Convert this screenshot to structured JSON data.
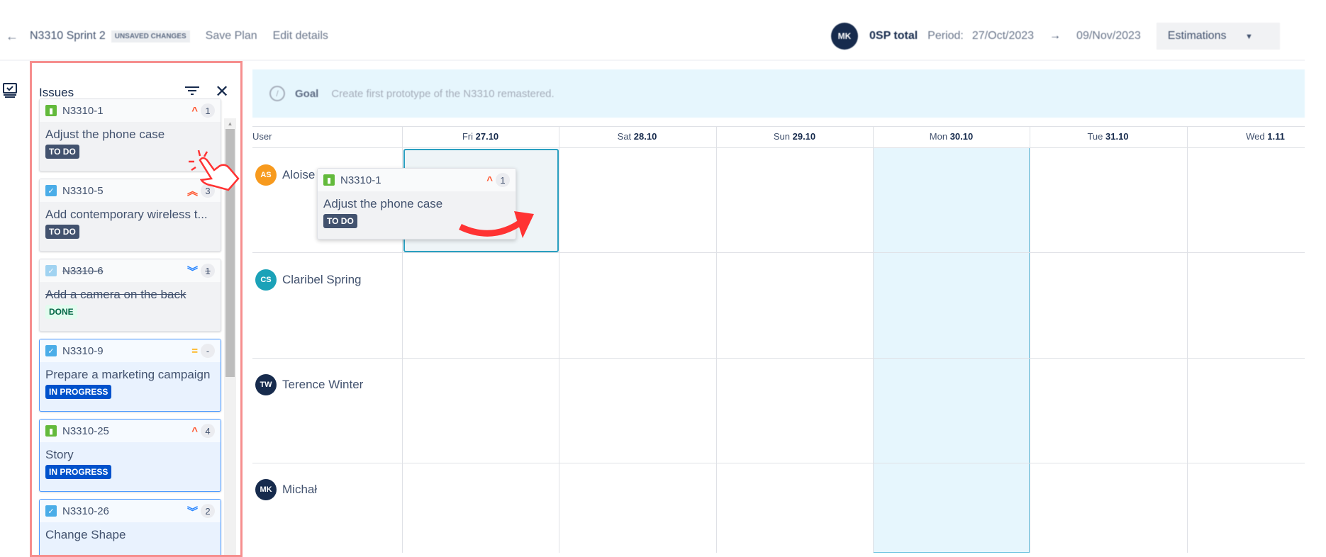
{
  "header": {
    "sprint_name": "N3310 Sprint 2",
    "unsaved_badge": "UNSAVED CHANGES",
    "save_plan": "Save Plan",
    "edit_details": "Edit details",
    "user_initials": "MK",
    "total": "0SP total",
    "period_label": "Period:",
    "period_start": "27/Oct/2023",
    "period_end": "09/Nov/2023",
    "estimations": "Estimations"
  },
  "issues_panel": {
    "title": "Issues",
    "issues": [
      {
        "key": "N3310-1",
        "type": "story",
        "priority": "high",
        "points": "1",
        "title": "Adjust the phone case",
        "status": "TO DO"
      },
      {
        "key": "N3310-5",
        "type": "task",
        "priority": "highest",
        "points": "3",
        "title": "Add contemporary wireless t...",
        "status": "TO DO"
      },
      {
        "key": "N3310-6",
        "type": "task",
        "priority": "lowest",
        "points": "1",
        "title": "Add a camera on the back",
        "status": "DONE"
      },
      {
        "key": "N3310-9",
        "type": "task",
        "priority": "medium",
        "points": "-",
        "title": "Prepare a marketing campaign",
        "status": "IN PROGRESS"
      },
      {
        "key": "N3310-25",
        "type": "story",
        "priority": "high",
        "points": "4",
        "title": "Story",
        "status": "IN PROGRESS"
      },
      {
        "key": "N3310-26",
        "type": "task",
        "priority": "lowest",
        "points": "2",
        "title": "Change Shape",
        "status": ""
      }
    ]
  },
  "goal": {
    "label": "Goal",
    "text": "Create first prototype of the N3310 remastered."
  },
  "grid": {
    "user_header": "User",
    "days": [
      {
        "dow": "Fri",
        "date": "27.10"
      },
      {
        "dow": "Sat",
        "date": "28.10"
      },
      {
        "dow": "Sun",
        "date": "29.10"
      },
      {
        "dow": "Mon",
        "date": "30.10"
      },
      {
        "dow": "Tue",
        "date": "31.10"
      },
      {
        "dow": "Wed",
        "date": "1.11"
      }
    ],
    "users": [
      {
        "initials": "AS",
        "name": "Aloise",
        "color": "#f79a1e"
      },
      {
        "initials": "CS",
        "name": "Claribel Spring",
        "color": "#1ba2b8"
      },
      {
        "initials": "TW",
        "name": "Terence Winter",
        "color": "#172b4d"
      },
      {
        "initials": "MK",
        "name": "Michał",
        "color": "#172b4d"
      }
    ]
  },
  "dragged_card": {
    "key": "N3310-1",
    "points": "1",
    "title": "Adjust the phone case",
    "status": "TO DO"
  },
  "colors": {
    "highlight": "#e6f6fd",
    "drop_border": "#2a9fc0",
    "panel_border": "#f68e8e"
  }
}
